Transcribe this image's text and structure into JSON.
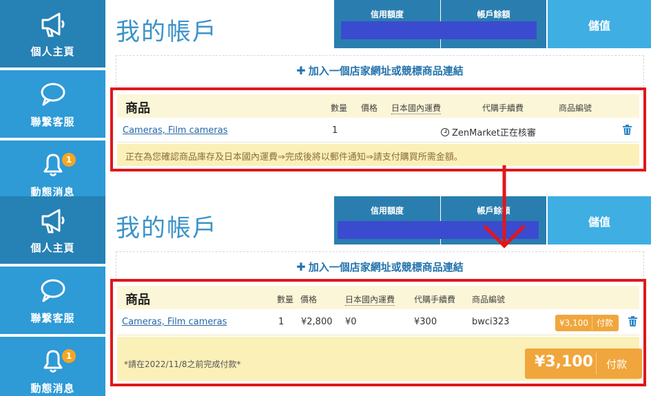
{
  "sidebar": {
    "items": [
      {
        "label": "個人主頁",
        "icon": "megaphone-icon"
      },
      {
        "label": "聯繫客服",
        "icon": "chat-bubble-icon"
      },
      {
        "label": "動態消息",
        "icon": "bell-icon",
        "badge": "1"
      }
    ]
  },
  "header": {
    "title": "我的帳戶",
    "credit_label": "信用額度",
    "balance_label": "帳戶餘額",
    "topup_label": "儲值"
  },
  "add_link": {
    "label": "加入一個店家網址或競標商品連結"
  },
  "before": {
    "columns": {
      "product": "商品",
      "quantity": "數量",
      "price": "價格",
      "domestic_shipping": "日本國內運費",
      "service_fee": "代購手續費",
      "item_code": "商品編號"
    },
    "row": {
      "name": "Cameras, Film cameras",
      "quantity": "1",
      "status": "ZenMarket正在核審"
    },
    "notice": "正在為您確認商品庫存及日本國內運費⇒完成後將以郵件通知⇒請支付購買所需金額。"
  },
  "after": {
    "columns": {
      "product": "商品",
      "quantity": "數量",
      "price": "價格",
      "domestic_shipping": "日本國內運費",
      "service_fee": "代購手續費",
      "item_code": "商品編號"
    },
    "row": {
      "name": "Cameras, Film cameras",
      "quantity": "1",
      "price": "¥2,800",
      "domestic_shipping": "¥0",
      "service_fee": "¥300",
      "item_code": "bwci323",
      "total": "¥3,100",
      "pay_label": "付款"
    },
    "deadline": "*請在2022/11/8之前完成付款*",
    "grand_total": "¥3,100",
    "pay_label": "付款"
  },
  "colors": {
    "sidebar_active": "#2681b4",
    "sidebar": "#2e9ad6",
    "title": "#3c93c9",
    "highlight": "#e0171b",
    "accent": "#f0a63c",
    "redaction": "#3b4bcf"
  }
}
